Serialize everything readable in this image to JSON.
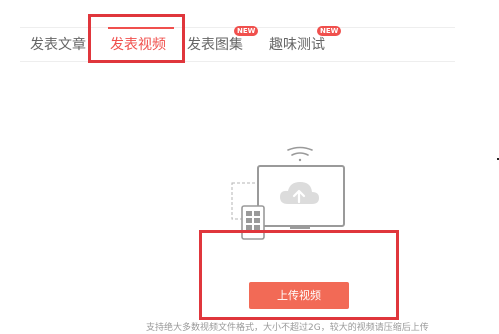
{
  "tabs": [
    {
      "label": "发表文章"
    },
    {
      "label": "发表视频",
      "active": true
    },
    {
      "label": "发表图集",
      "badge": "NEW"
    },
    {
      "label": "趣味测试",
      "badge": "NEW"
    }
  ],
  "upload": {
    "button_label": "上传视频",
    "hint": "支持绝大多数视频文件格式，大小不超过2G，较大的视频请压缩后上传"
  },
  "colors": {
    "accent": "#f0504d",
    "highlight_box": "#e0363c",
    "button": "#f26a56"
  },
  "icons": [
    "wifi-icon",
    "monitor-icon",
    "cloud-upload-icon",
    "tablet-icon"
  ]
}
